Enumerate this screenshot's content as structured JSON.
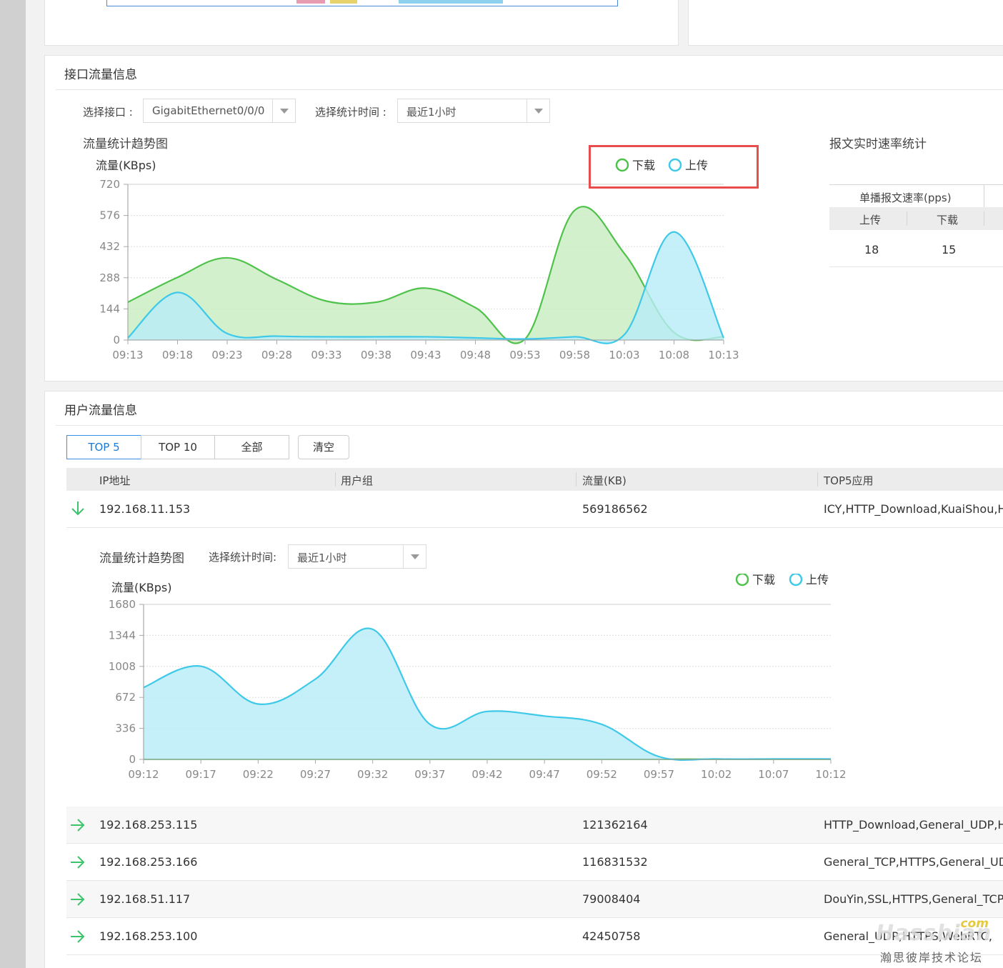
{
  "iface_section": {
    "title": "接口流量信息",
    "iface_label": "选择接口 :",
    "iface_value": "GigabitEthernet0/0/0",
    "time_label": "选择统计时间 :",
    "time_value": "最近1小时",
    "chart_title": "流量统计趋势图",
    "packet_rate": {
      "title": "报文实时速率统计",
      "header": "单播报文速率(pps)",
      "col_upload": "上传",
      "col_download": "下载",
      "upload_value": "18",
      "download_value": "15"
    }
  },
  "user_section": {
    "title": "用户流量信息",
    "tabs": [
      {
        "label": "TOP 5",
        "active": true
      },
      {
        "label": "TOP 10",
        "active": false
      },
      {
        "label": "全部",
        "active": false
      }
    ],
    "clear_label": "清空",
    "columns": [
      "IP地址",
      "用户组",
      "流量(KB)",
      "TOP5应用"
    ],
    "expanded_row": {
      "ip": "192.168.11.153",
      "group": "",
      "traffic": "569186562",
      "apps": "ICY,HTTP_Download,KuaiShou,HTT"
    },
    "detail": {
      "chart_title": "流量统计趋势图",
      "time_label": "选择统计时间:",
      "time_value": "最近1小时"
    },
    "rows": [
      {
        "ip": "192.168.253.115",
        "group": "",
        "traffic": "121362164",
        "apps": "HTTP_Download,General_UDP,HTT"
      },
      {
        "ip": "192.168.253.166",
        "group": "",
        "traffic": "116831532",
        "apps": "General_TCP,HTTPS,General_UDP,"
      },
      {
        "ip": "192.168.51.117",
        "group": "",
        "traffic": "79008404",
        "apps": "DouYin,SSL,HTTPS,General_TCP,Di"
      },
      {
        "ip": "192.168.253.100",
        "group": "",
        "traffic": "42450758",
        "apps": "General_UDP,HTTPS,WebRTC,"
      }
    ]
  },
  "watermark": {
    "brand": "Hassbian",
    "suffix": ".com",
    "subtitle": "瀚思彼岸技术论坛"
  },
  "colors": {
    "download": "#4ec24a",
    "upload": "#3ec9e8",
    "download_fill": "#c8ecc0",
    "upload_fill": "#b8ecf8",
    "highlight_box": "#e84c4c",
    "accent": "#1a7ad6"
  },
  "chart_data": [
    {
      "type": "area",
      "ylabel": "流量(KBps)",
      "x": [
        "09:13",
        "09:18",
        "09:23",
        "09:28",
        "09:33",
        "09:38",
        "09:43",
        "09:48",
        "09:53",
        "09:58",
        "10:03",
        "10:08",
        "10:13"
      ],
      "yticks": [
        0,
        144,
        288,
        432,
        576,
        720
      ],
      "ylim": [
        0,
        720
      ],
      "legend_position": "top-right",
      "series": [
        {
          "name": "下载",
          "color": "#4ec24a",
          "values": [
            175,
            290,
            380,
            280,
            180,
            175,
            240,
            150,
            5,
            600,
            400,
            35,
            15
          ]
        },
        {
          "name": "上传",
          "color": "#3ec9e8",
          "values": [
            10,
            220,
            30,
            18,
            15,
            15,
            15,
            10,
            5,
            15,
            25,
            500,
            10
          ]
        }
      ]
    },
    {
      "type": "area",
      "ylabel": "流量(KBps)",
      "x": [
        "09:12",
        "09:17",
        "09:22",
        "09:27",
        "09:32",
        "09:37",
        "09:42",
        "09:47",
        "09:52",
        "09:57",
        "10:02",
        "10:07",
        "10:12"
      ],
      "yticks": [
        0,
        336,
        672,
        1008,
        1344,
        1680
      ],
      "ylim": [
        0,
        1680
      ],
      "legend_position": "top-right",
      "series": [
        {
          "name": "下载",
          "color": "#4ec24a",
          "values": [
            2,
            2,
            2,
            2,
            2,
            2,
            2,
            2,
            2,
            2,
            2,
            2,
            2
          ]
        },
        {
          "name": "上传",
          "color": "#3ec9e8",
          "values": [
            780,
            1010,
            600,
            870,
            1410,
            380,
            520,
            470,
            380,
            30,
            5,
            5,
            5
          ]
        }
      ]
    }
  ]
}
